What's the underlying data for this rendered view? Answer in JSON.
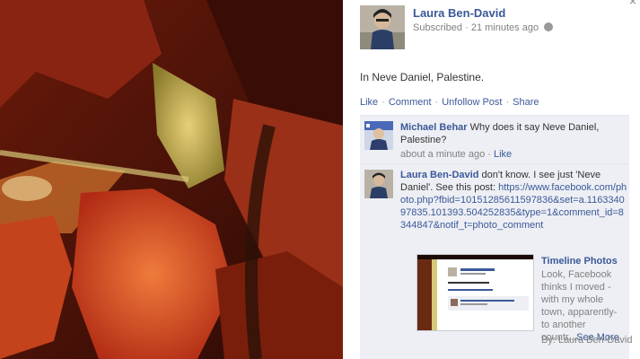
{
  "photo": {
    "alt": "autumn grape leaves"
  },
  "header": {
    "close_label": "×",
    "owner_name": "Laura Ben-David",
    "subscribed": "Subscribed",
    "time": "21 minutes ago"
  },
  "post": {
    "caption": "In Neve Daniel, Palestine."
  },
  "actions": {
    "like": "Like",
    "comment": "Comment",
    "unfollow": "Unfollow Post",
    "share": "Share"
  },
  "comments": [
    {
      "author": "Michael Behar",
      "text": "Why does it say Neve Daniel, Palestine?",
      "time": "about a minute ago",
      "like": "Like"
    },
    {
      "author": "Laura Ben-David",
      "text": "don't know. I see just 'Neve Daniel'. See this post:",
      "url": "https://www.facebook.com/photo.php?fbid=10151285611597836&set=a.116334097835.101393.504252835&type=1&comment_id=8344847&notif_t=photo_comment"
    }
  ],
  "attachment": {
    "title": "Timeline Photos",
    "description": "Look, Facebook thinks I moved -with my whole town, apparently- to another countr...",
    "see_more": "See More",
    "by": "By: Laura Ben-David",
    "thumb_name": "Laura Ben-David",
    "thumb_caption": "In Neve Daniel, Palestine."
  }
}
